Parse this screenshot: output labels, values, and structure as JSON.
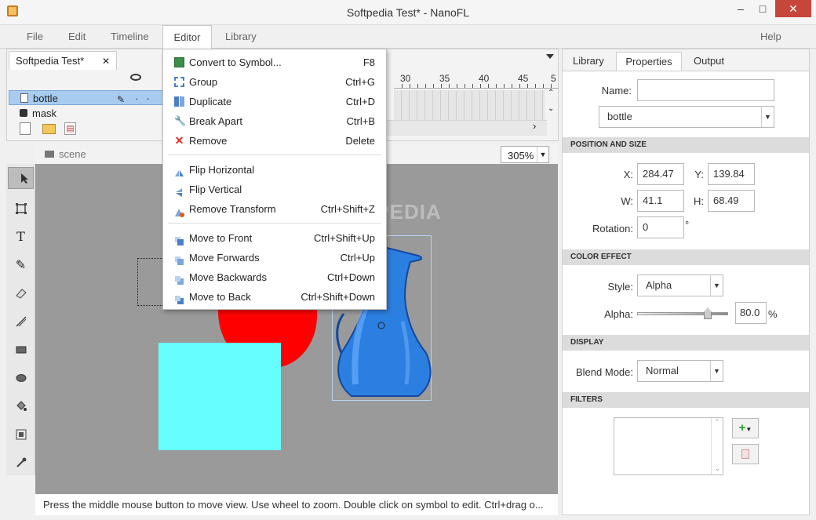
{
  "window": {
    "title": "Softpedia Test* - NanoFL",
    "minimize": "–",
    "restore": "□",
    "close": "✕"
  },
  "menubar": {
    "items": [
      "File",
      "Edit",
      "Timeline",
      "Editor",
      "Library"
    ],
    "help": "Help"
  },
  "document": {
    "tab_label": "Softpedia Test*",
    "tab_close": "✕"
  },
  "layers": [
    {
      "name": "bottle"
    },
    {
      "name": "mask"
    }
  ],
  "timeline": {
    "ruler": [
      "30",
      "35",
      "40",
      "45",
      "5"
    ]
  },
  "scene": {
    "label": "scene",
    "zoom": "305%"
  },
  "status": {
    "text": "Press the middle mouse button to move view. Use wheel to zoom. Double click on symbol to edit. Ctrl+drag o..."
  },
  "watermark": "SOFTPEDIA",
  "editor_menu": {
    "items": [
      {
        "label": "Convert to Symbol...",
        "shortcut": "F8",
        "icon": "convert-symbol-icon"
      },
      {
        "label": "Group",
        "shortcut": "Ctrl+G",
        "icon": "group-icon"
      },
      {
        "label": "Duplicate",
        "shortcut": "Ctrl+D",
        "icon": "duplicate-icon"
      },
      {
        "label": "Break Apart",
        "shortcut": "Ctrl+B",
        "icon": "break-apart-icon"
      },
      {
        "label": "Remove",
        "shortcut": "Delete",
        "icon": "remove-icon"
      },
      {
        "label": "Flip Horizontal",
        "shortcut": "",
        "icon": "flip-horizontal-icon"
      },
      {
        "label": "Flip Vertical",
        "shortcut": "",
        "icon": "flip-vertical-icon"
      },
      {
        "label": "Remove Transform",
        "shortcut": "Ctrl+Shift+Z",
        "icon": "remove-transform-icon"
      },
      {
        "label": "Move to Front",
        "shortcut": "Ctrl+Shift+Up",
        "icon": "move-front-icon"
      },
      {
        "label": "Move Forwards",
        "shortcut": "Ctrl+Up",
        "icon": "move-forwards-icon"
      },
      {
        "label": "Move Backwards",
        "shortcut": "Ctrl+Down",
        "icon": "move-backwards-icon"
      },
      {
        "label": "Move to Back",
        "shortcut": "Ctrl+Shift+Down",
        "icon": "move-back-icon"
      }
    ]
  },
  "right_panel": {
    "tabs": [
      "Library",
      "Properties",
      "Output"
    ],
    "name_label": "Name:",
    "name_value": "",
    "symbol": "bottle",
    "position_section": "POSITION AND SIZE",
    "x_label": "X:",
    "x": "284.47",
    "y_label": "Y:",
    "y": "139.84",
    "w_label": "W:",
    "w": "41.1",
    "h_label": "H:",
    "h": "68.49",
    "rotation_label": "Rotation:",
    "rotation": "0",
    "degree": "°",
    "color_section": "COLOR EFFECT",
    "style_label": "Style:",
    "style": "Alpha",
    "alpha_label": "Alpha:",
    "alpha": "80.0",
    "percent": "%",
    "alpha_level": 0.8,
    "display_section": "DISPLAY",
    "blend_label": "Blend Mode:",
    "blend": "Normal",
    "filters_section": "FILTERS"
  },
  "colors": {
    "cyan_square": "#66ffff",
    "red_shape": "#ff0000",
    "bottle": "#2b7fe0",
    "stage": "#9a9a9a"
  }
}
